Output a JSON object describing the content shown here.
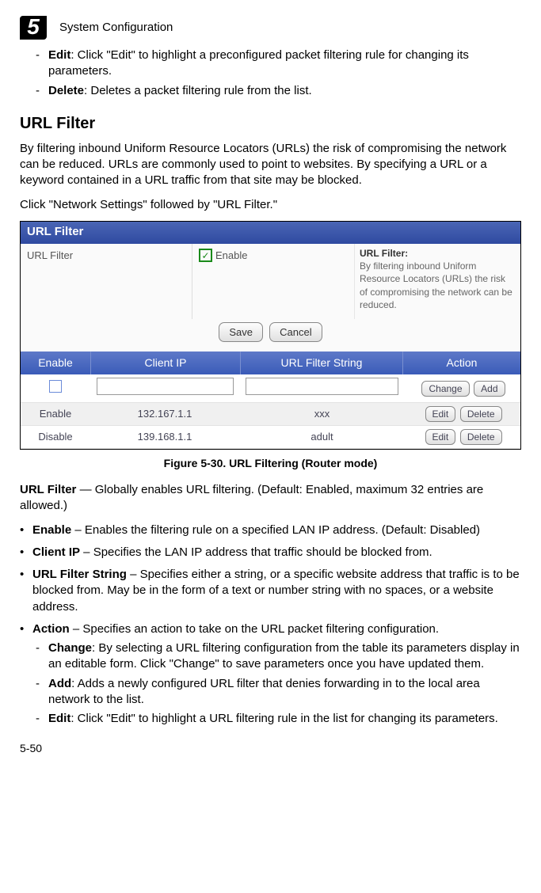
{
  "header": {
    "chapter_num": "5",
    "chapter_title": "System Configuration"
  },
  "intro_items": [
    {
      "term": "Edit",
      "desc": ": Click \"Edit\" to highlight a preconfigured packet filtering rule for changing its parameters."
    },
    {
      "term": "Delete",
      "desc": ": Deletes a packet filtering rule from the list."
    }
  ],
  "section": {
    "title": "URL Filter",
    "p1": "By filtering inbound Uniform Resource Locators (URLs) the risk of compromising the network can be reduced. URLs are commonly used to point to websites. By specifying a URL or a keyword contained in a URL traffic from that site may be blocked.",
    "p2": "Click \"Network Settings\" followed by \"URL Filter.\""
  },
  "figure": {
    "titlebar": "URL Filter",
    "left_label": "URL Filter",
    "enable_label": "Enable",
    "help_title": "URL Filter:",
    "help_body": "By filtering inbound Uniform Resource Locators (URLs) the risk of compromising the network can be reduced.",
    "save_btn": "Save",
    "cancel_btn": "Cancel",
    "cols": {
      "enable": "Enable",
      "client_ip": "Client IP",
      "filter_string": "URL Filter String",
      "action": "Action"
    },
    "new_row_buttons": {
      "change": "Change",
      "add": "Add"
    },
    "rows": [
      {
        "enable": "Enable",
        "ip": "132.167.1.1",
        "str": "xxx",
        "b1": "Edit",
        "b2": "Delete"
      },
      {
        "enable": "Disable",
        "ip": "139.168.1.1",
        "str": "adult",
        "b1": "Edit",
        "b2": "Delete"
      }
    ],
    "caption": "Figure 5-30.   URL Filtering (Router mode)"
  },
  "defs": {
    "url_filter_pre": "URL Filter",
    "url_filter_post": " — Globally enables URL filtering. (Default: Enabled, maximum 32 entries are allowed.)",
    "items": [
      {
        "term": "Enable",
        "desc": " – Enables the filtering rule on a specified LAN IP address. (Default: Disabled)"
      },
      {
        "term": "Client IP",
        "desc": " – Specifies the LAN IP address that traffic should be blocked from."
      },
      {
        "term": "URL Filter String",
        "desc": " – Specifies either a string, or a specific website address that traffic is to be blocked from. May be in the form of a text or number string with no spaces, or a website address."
      }
    ],
    "action_term": "Action",
    "action_desc": " – Specifies an action to take on the URL packet filtering configuration.",
    "action_sub": [
      {
        "term": "Change",
        "desc": ": By selecting a URL filtering configuration from the table its parameters display in an editable form. Click \"Change\" to save parameters once you have updated them."
      },
      {
        "term": "Add",
        "desc": ": Adds a newly configured URL filter that denies forwarding in to the local area network to the list."
      },
      {
        "term": "Edit",
        "desc": ": Click \"Edit\" to highlight a URL filtering rule in the list for changing its parameters."
      }
    ]
  },
  "footer": "5-50"
}
